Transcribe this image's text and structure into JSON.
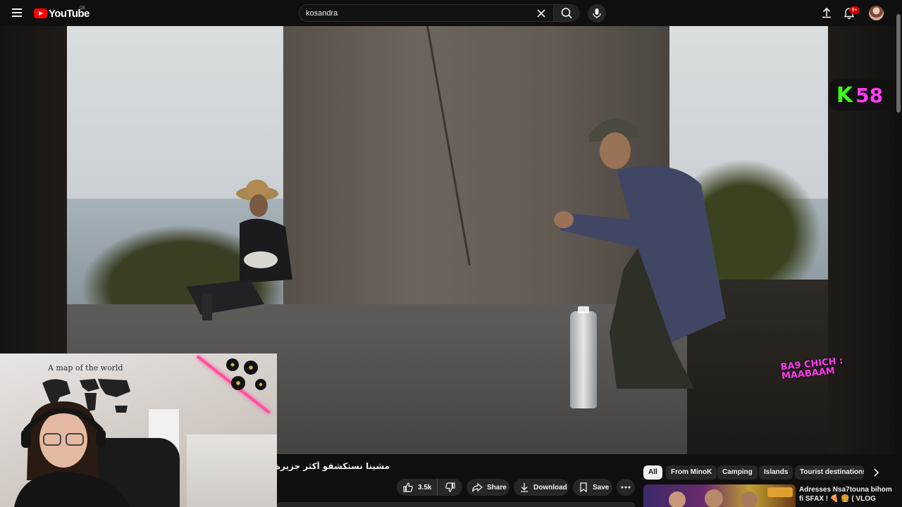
{
  "header": {
    "logo_text": "YouTube",
    "country_code": "DE",
    "search_value": "kosandra",
    "notification_count": "9+"
  },
  "video_overlay": {
    "badge_letter": "K",
    "badge_number": "58",
    "caption": "BA9 CHICH : MAABAAM"
  },
  "facecam": {
    "map_title": "A map of the world"
  },
  "video_info": {
    "title": "مشينا نستكشفو أكثر جزيرة خ 😱"
  },
  "actions": {
    "like_count": "3.5k",
    "share_label": "Share",
    "download_label": "Download",
    "save_label": "Save"
  },
  "chips": [
    {
      "label": "All",
      "active": true
    },
    {
      "label": "From MinoK",
      "active": false
    },
    {
      "label": "Camping",
      "active": false
    },
    {
      "label": "Islands",
      "active": false
    },
    {
      "label": "Tourist destinations",
      "active": false
    }
  ],
  "recommendation": {
    "title": "Adresses Nsa7touna bihom fi SFAX ! 🍕 🍔 ( VLOG"
  },
  "colors": {
    "accent": "#ff0000",
    "badge_green": "#39ff14",
    "badge_pink": "#ff3cf0"
  }
}
